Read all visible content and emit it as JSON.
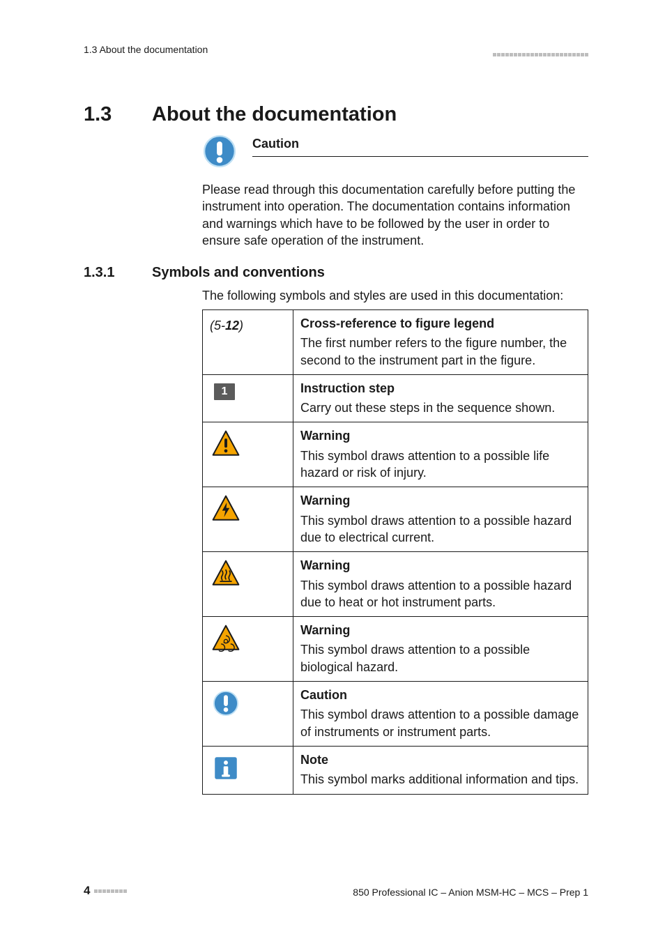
{
  "header": {
    "left": "1.3 About the documentation"
  },
  "section": {
    "number": "1.3",
    "title": "About the documentation"
  },
  "caution": {
    "title": "Caution",
    "body": "Please read through this documentation carefully before putting the instrument into operation. The documentation contains information and warnings which have to be followed by the user in order to ensure safe operation of the instrument."
  },
  "subsection": {
    "number": "1.3.1",
    "title": "Symbols and conventions",
    "intro": "The following symbols and styles are used in this documentation:"
  },
  "conventions": [
    {
      "symbol_key": "xref",
      "xref_a": "(5-",
      "xref_b": "12",
      "xref_c": ")",
      "title": "Cross-reference to figure legend",
      "desc": "The first number refers to the figure number, the second to the instrument part in the figure."
    },
    {
      "symbol_key": "step",
      "step_num": "1",
      "title": "Instruction step",
      "desc": "Carry out these steps in the sequence shown."
    },
    {
      "symbol_key": "warn-life",
      "icon_name": "warning-exclamation-icon",
      "title": "Warning",
      "desc": "This symbol draws attention to a possible life hazard or risk of injury."
    },
    {
      "symbol_key": "warn-elec",
      "icon_name": "warning-electric-icon",
      "title": "Warning",
      "desc": "This symbol draws attention to a possible hazard due to electrical current."
    },
    {
      "symbol_key": "warn-heat",
      "icon_name": "warning-heat-icon",
      "title": "Warning",
      "desc": "This symbol draws attention to a possible hazard due to heat or hot instrument parts."
    },
    {
      "symbol_key": "warn-bio",
      "icon_name": "warning-biohazard-icon",
      "title": "Warning",
      "desc": "This symbol draws attention to a possible biological hazard."
    },
    {
      "symbol_key": "caution",
      "icon_name": "caution-circle-icon",
      "title": "Caution",
      "desc": "This symbol draws attention to a possible damage of instruments or instrument parts."
    },
    {
      "symbol_key": "note",
      "icon_name": "info-square-icon",
      "title": "Note",
      "desc": "This symbol marks additional information and tips."
    }
  ],
  "footer": {
    "page": "4",
    "right": "850 Professional IC – Anion MSM-HC – MCS – Prep 1"
  },
  "colors": {
    "warn_yellow": "#f5a400",
    "caution_blue": "#3e8bc7",
    "note_blue": "#3e8bc7"
  }
}
